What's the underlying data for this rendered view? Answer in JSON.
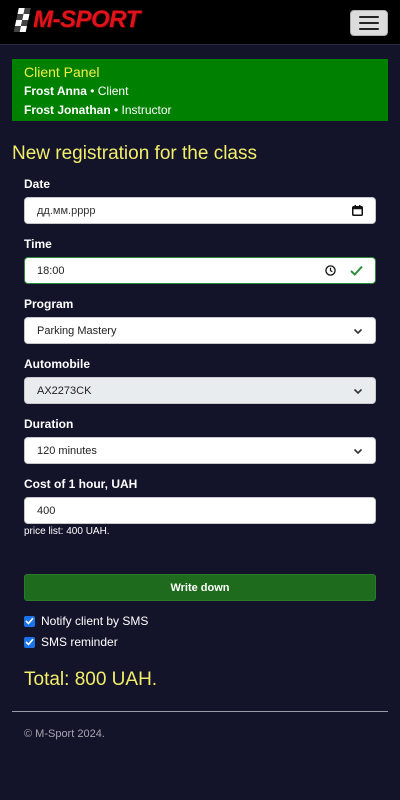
{
  "brand": {
    "name": "M-SPORT"
  },
  "client_panel": {
    "title": "Client Panel",
    "client_name": "Frost Anna",
    "client_role": " • Client",
    "instructor_name": "Frost Jonathan",
    "instructor_role": " • Instructor"
  },
  "page_title": "New registration for the class",
  "form": {
    "date": {
      "label": "Date",
      "placeholder": "дд.мм.рррр"
    },
    "time": {
      "label": "Time",
      "value": "18:00"
    },
    "program": {
      "label": "Program",
      "value": "Parking Mastery"
    },
    "automobile": {
      "label": "Automobile",
      "value": "AX2273CK"
    },
    "duration": {
      "label": "Duration",
      "value": "120 minutes"
    },
    "cost": {
      "label": "Cost of 1 hour, UAH",
      "value": "400"
    },
    "price_hint": "price list: 400 UAH.",
    "submit_label": "Write down",
    "notify_sms": {
      "label": "Notify client by SMS",
      "checked": true
    },
    "sms_reminder": {
      "label": "SMS reminder",
      "checked": true
    }
  },
  "total": "Total: 800 UAH.",
  "footer": "© M-Sport 2024.",
  "colors": {
    "background": "#13132a",
    "panel_green": "#008000",
    "accent_yellow": "#f2ee6a",
    "brand_red": "#e0121b",
    "submit_green": "#1e6b1e"
  },
  "icons": [
    "checkered-flag-icon",
    "hamburger-menu-icon",
    "calendar-icon",
    "clock-icon",
    "check-icon",
    "chevron-down-icon",
    "checkbox-checked-icon"
  ]
}
